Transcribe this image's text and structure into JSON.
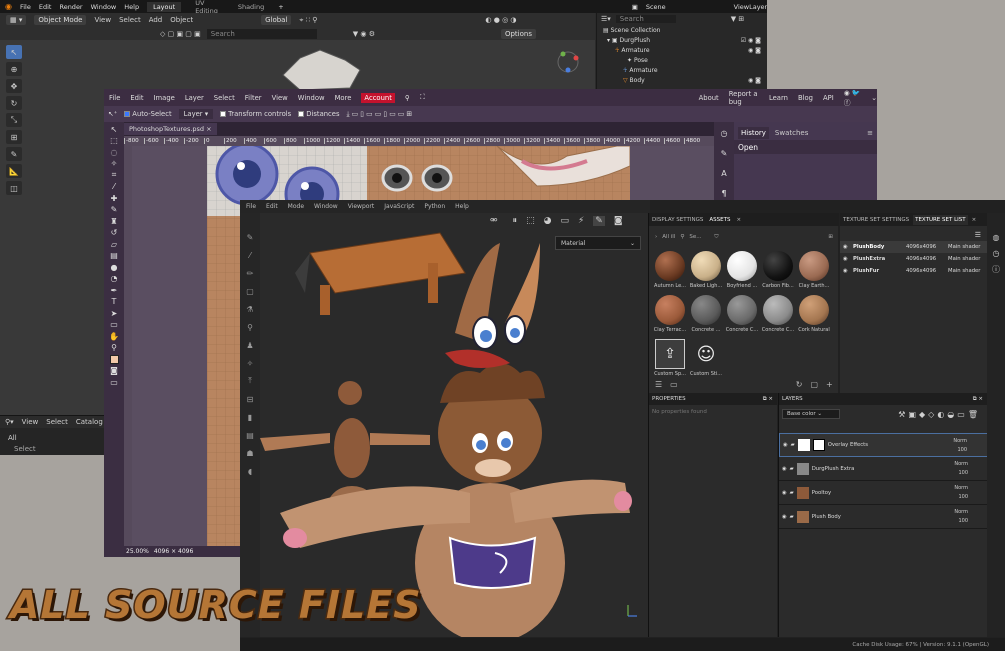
{
  "blender": {
    "menu": [
      "File",
      "Edit",
      "Render",
      "Window",
      "Help"
    ],
    "workspace_tabs": [
      {
        "label": "Layout",
        "active": true
      },
      {
        "label": "UV Editing",
        "active": false
      },
      {
        "label": "Shading",
        "active": false
      }
    ],
    "mode": "Object Mode",
    "header_menu": [
      "View",
      "Select",
      "Add",
      "Object"
    ],
    "transform": "Global",
    "options_label": "Options",
    "search_placeholder": "Search",
    "scene_label": "Scene",
    "viewlayer_label": "ViewLayer",
    "outliner_search": "Search",
    "outliner": [
      "Scene Collection",
      "DurgPlush",
      "Armature",
      "Pose",
      "Armature",
      "Body"
    ],
    "timeline_menu": [
      "View",
      "Select",
      "Catalog"
    ],
    "timeline_all": "All",
    "timeline_select": "Select"
  },
  "photopea": {
    "menu": [
      "File",
      "Edit",
      "Image",
      "Layer",
      "Select",
      "Filter",
      "View",
      "Window",
      "More"
    ],
    "account": "Account",
    "right_menu": [
      "About",
      "Report a bug",
      "Learn",
      "Blog",
      "API"
    ],
    "auto_select": "Auto-Select",
    "layer_dd": "Layer",
    "transform_controls": "Transform controls",
    "distances": "Distances",
    "tab_title": "PhotoshopTextures.psd",
    "ruler": [
      "-800",
      "-600",
      "-400",
      "-200",
      "0",
      "200",
      "400",
      "600",
      "800",
      "1000",
      "1200",
      "1400",
      "1600",
      "1800",
      "2000",
      "2200",
      "2400",
      "2600",
      "2800",
      "3000",
      "3200",
      "3400",
      "3600",
      "3800",
      "4000",
      "4200",
      "4400",
      "4600",
      "4800"
    ],
    "zoom": "25.00%",
    "doc_size": "4096 × 4096",
    "panel_tabs": [
      "History",
      "Swatches"
    ],
    "history_item": "Open"
  },
  "painter": {
    "menu": [
      "File",
      "Edit",
      "Mode",
      "Window",
      "Viewport",
      "JavaScript",
      "Python",
      "Help"
    ],
    "material_dd": "Material",
    "assets_tabs": [
      "DISPLAY SETTINGS",
      "ASSETS"
    ],
    "assets_filter": "All ill",
    "assets_search": "Se...",
    "assets": [
      {
        "label": "Autumn Le...",
        "color": "#6a3a22"
      },
      {
        "label": "Baked Ligh...",
        "color": "#c9b089"
      },
      {
        "label": "Boyfriend ...",
        "color": "#e4e4e4"
      },
      {
        "label": "Carbon Fib...",
        "color": "#121212"
      },
      {
        "label": "Clay Earth...",
        "color": "#9a6a52"
      },
      {
        "label": "Clay Terrac...",
        "color": "#9b5a3a"
      },
      {
        "label": "Concrete ...",
        "color": "#5a5a5a"
      },
      {
        "label": "Concrete C...",
        "color": "#6a6a6a"
      },
      {
        "label": "Concrete C...",
        "color": "#8b8b8b"
      },
      {
        "label": "Cork Natural",
        "color": "#a47650"
      },
      {
        "label": "Custom Sp...",
        "color": "#3d3d3d"
      },
      {
        "label": "Custom Sti...",
        "color": "#3a3a3a"
      }
    ],
    "properties_title": "PROPERTIES",
    "properties_empty": "No properties found",
    "tss_tabs": [
      "TEXTURE SET SETTINGS",
      "TEXTURE SET LIST"
    ],
    "texture_sets": [
      {
        "name": "PlushBody",
        "size": "4096x4096",
        "shader": "Main shader"
      },
      {
        "name": "PlushExtra",
        "size": "4096x4096",
        "shader": "Main shader"
      },
      {
        "name": "PlushFur",
        "size": "4096x4096",
        "shader": "Main shader"
      }
    ],
    "layers_title": "LAYERS",
    "base_color": "Base color",
    "layers": [
      {
        "name": "Overlay Effects",
        "mode": "Norm",
        "opacity": "100"
      },
      {
        "name": "DurgPlush Extra",
        "mode": "Norm",
        "opacity": "100"
      },
      {
        "name": "Pooltoy",
        "mode": "Norm",
        "opacity": "100"
      },
      {
        "name": "Plush Body",
        "mode": "Norm",
        "opacity": "100"
      }
    ],
    "status": "Cache Disk Usage:  67% | Version: 9.1.1 (OpenGL)"
  },
  "banner": "ALL SOURCE FILES",
  "colors": {
    "account": "#c4122d",
    "banner": "#b57636",
    "blender_accent": "#4772b3"
  }
}
